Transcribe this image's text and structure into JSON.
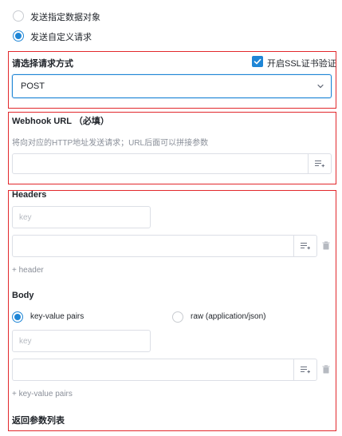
{
  "send_mode": {
    "option_object": "发送指定数据对象",
    "option_custom": "发送自定义请求"
  },
  "method_section": {
    "title": "请选择请求方式",
    "ssl_label": "开启SSL证书验证",
    "ssl_checked": true,
    "method_value": "POST"
  },
  "webhook_section": {
    "title": "Webhook URL （必填）",
    "hint": "将向对应的HTTP地址发送请求；URL后面可以拼接参数",
    "value": ""
  },
  "headers_section": {
    "title": "Headers",
    "key_placeholder": "key",
    "add_label": "+ header"
  },
  "body_section": {
    "title": "Body",
    "option_kv": "key-value pairs",
    "option_raw": "raw (application/json)",
    "key_placeholder": "key",
    "add_label": "+ key-value pairs"
  },
  "return_section": {
    "title": "返回参数列表"
  },
  "colors": {
    "accent": "#1f86d6",
    "section_border": "#e2282c"
  },
  "icons": {
    "insert_field": "insert-field-icon",
    "delete": "trash-icon",
    "chevron": "chevron-down-icon",
    "check": "check-icon"
  }
}
